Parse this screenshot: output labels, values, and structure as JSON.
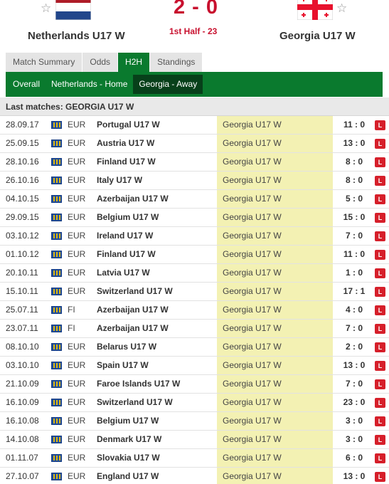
{
  "match": {
    "home_team": "Netherlands U17 W",
    "away_team": "Georgia U17 W",
    "score": "2 - 0",
    "status": "1st Half - 23"
  },
  "tabs": [
    {
      "label": "Match Summary",
      "active": false
    },
    {
      "label": "Odds",
      "active": false
    },
    {
      "label": "H2H",
      "active": true
    },
    {
      "label": "Standings",
      "active": false
    }
  ],
  "subtabs": [
    {
      "label": "Overall",
      "active": false
    },
    {
      "label": "Netherlands - Home",
      "active": false
    },
    {
      "label": "Georgia - Away",
      "active": true
    }
  ],
  "section_title": "Last matches: GEORGIA U17 W",
  "colors": {
    "accent": "#0a7a2e",
    "score": "#c8102e",
    "loss": "#d61f2a",
    "highlight": "#f3f1b3"
  },
  "matches": [
    {
      "date": "28.09.17",
      "comp": "EUR",
      "home": "Portugal U17 W",
      "away": "Georgia U17 W",
      "result": "11 : 0",
      "outcome": "L"
    },
    {
      "date": "25.09.15",
      "comp": "EUR",
      "home": "Austria U17 W",
      "away": "Georgia U17 W",
      "result": "13 : 0",
      "outcome": "L"
    },
    {
      "date": "28.10.16",
      "comp": "EUR",
      "home": "Finland U17 W",
      "away": "Georgia U17 W",
      "result": "8 : 0",
      "outcome": "L"
    },
    {
      "date": "26.10.16",
      "comp": "EUR",
      "home": "Italy U17 W",
      "away": "Georgia U17 W",
      "result": "8 : 0",
      "outcome": "L"
    },
    {
      "date": "04.10.15",
      "comp": "EUR",
      "home": "Azerbaijan U17 W",
      "away": "Georgia U17 W",
      "result": "5 : 0",
      "outcome": "L"
    },
    {
      "date": "29.09.15",
      "comp": "EUR",
      "home": "Belgium U17 W",
      "away": "Georgia U17 W",
      "result": "15 : 0",
      "outcome": "L"
    },
    {
      "date": "03.10.12",
      "comp": "EUR",
      "home": "Ireland U17 W",
      "away": "Georgia U17 W",
      "result": "7 : 0",
      "outcome": "L"
    },
    {
      "date": "01.10.12",
      "comp": "EUR",
      "home": "Finland U17 W",
      "away": "Georgia U17 W",
      "result": "11 : 0",
      "outcome": "L"
    },
    {
      "date": "20.10.11",
      "comp": "EUR",
      "home": "Latvia U17 W",
      "away": "Georgia U17 W",
      "result": "1 : 0",
      "outcome": "L"
    },
    {
      "date": "15.10.11",
      "comp": "EUR",
      "home": "Switzerland U17 W",
      "away": "Georgia U17 W",
      "result": "17 : 1",
      "outcome": "L"
    },
    {
      "date": "25.07.11",
      "comp": "FI",
      "home": "Azerbaijan U17 W",
      "away": "Georgia U17 W",
      "result": "4 : 0",
      "outcome": "L"
    },
    {
      "date": "23.07.11",
      "comp": "FI",
      "home": "Azerbaijan U17 W",
      "away": "Georgia U17 W",
      "result": "7 : 0",
      "outcome": "L"
    },
    {
      "date": "08.10.10",
      "comp": "EUR",
      "home": "Belarus U17 W",
      "away": "Georgia U17 W",
      "result": "2 : 0",
      "outcome": "L"
    },
    {
      "date": "03.10.10",
      "comp": "EUR",
      "home": "Spain U17 W",
      "away": "Georgia U17 W",
      "result": "13 : 0",
      "outcome": "L"
    },
    {
      "date": "21.10.09",
      "comp": "EUR",
      "home": "Faroe Islands U17 W",
      "away": "Georgia U17 W",
      "result": "7 : 0",
      "outcome": "L"
    },
    {
      "date": "16.10.09",
      "comp": "EUR",
      "home": "Switzerland U17 W",
      "away": "Georgia U17 W",
      "result": "23 : 0",
      "outcome": "L"
    },
    {
      "date": "16.10.08",
      "comp": "EUR",
      "home": "Belgium U17 W",
      "away": "Georgia U17 W",
      "result": "3 : 0",
      "outcome": "L"
    },
    {
      "date": "14.10.08",
      "comp": "EUR",
      "home": "Denmark U17 W",
      "away": "Georgia U17 W",
      "result": "3 : 0",
      "outcome": "L"
    },
    {
      "date": "01.11.07",
      "comp": "EUR",
      "home": "Slovakia U17 W",
      "away": "Georgia U17 W",
      "result": "6 : 0",
      "outcome": "L"
    },
    {
      "date": "27.10.07",
      "comp": "EUR",
      "home": "England U17 W",
      "away": "Georgia U17 W",
      "result": "13 : 0",
      "outcome": "L"
    }
  ]
}
